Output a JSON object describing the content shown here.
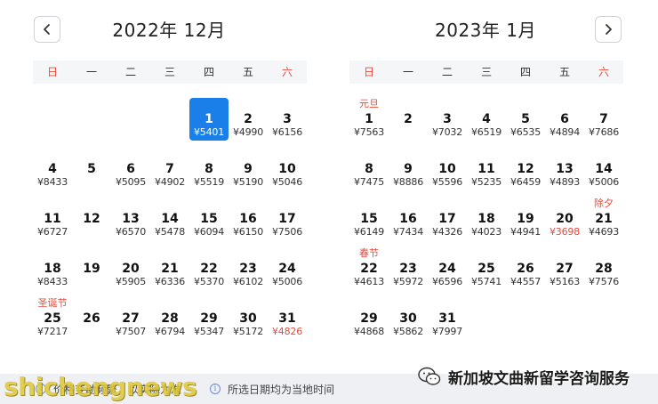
{
  "nav": {
    "prev_icon": "chevron-left-icon",
    "next_icon": "chevron-right-icon"
  },
  "calendars": [
    {
      "title": "2022年 12月",
      "weekdays": [
        "日",
        "一",
        "二",
        "三",
        "四",
        "五",
        "六"
      ],
      "offset": 4,
      "days": [
        {
          "d": "1",
          "p": "¥5401",
          "selected": true
        },
        {
          "d": "2",
          "p": "¥4990"
        },
        {
          "d": "3",
          "p": "¥6156"
        },
        {
          "d": "4",
          "p": "¥8433"
        },
        {
          "d": "5",
          "p": ""
        },
        {
          "d": "6",
          "p": "¥5095"
        },
        {
          "d": "7",
          "p": "¥4902"
        },
        {
          "d": "8",
          "p": "¥5519"
        },
        {
          "d": "9",
          "p": "¥5190"
        },
        {
          "d": "10",
          "p": "¥5046"
        },
        {
          "d": "11",
          "p": "¥6727"
        },
        {
          "d": "12",
          "p": ""
        },
        {
          "d": "13",
          "p": "¥6570"
        },
        {
          "d": "14",
          "p": "¥5478"
        },
        {
          "d": "15",
          "p": "¥6094"
        },
        {
          "d": "16",
          "p": "¥6150"
        },
        {
          "d": "17",
          "p": "¥7506"
        },
        {
          "d": "18",
          "p": "¥8433"
        },
        {
          "d": "19",
          "p": ""
        },
        {
          "d": "20",
          "p": "¥5905"
        },
        {
          "d": "21",
          "p": "¥6336"
        },
        {
          "d": "22",
          "p": "¥5370"
        },
        {
          "d": "23",
          "p": "¥6102"
        },
        {
          "d": "24",
          "p": "¥5006"
        },
        {
          "d": "25",
          "p": "¥7217",
          "holiday": "圣诞节"
        },
        {
          "d": "26",
          "p": ""
        },
        {
          "d": "27",
          "p": "¥7507"
        },
        {
          "d": "28",
          "p": "¥6794"
        },
        {
          "d": "29",
          "p": "¥5347"
        },
        {
          "d": "30",
          "p": "¥5172"
        },
        {
          "d": "31",
          "p": "¥4826",
          "low": true
        }
      ]
    },
    {
      "title": "2023年 1月",
      "weekdays": [
        "日",
        "一",
        "二",
        "三",
        "四",
        "五",
        "六"
      ],
      "offset": 0,
      "days": [
        {
          "d": "1",
          "p": "¥7563",
          "holiday": "元旦"
        },
        {
          "d": "2",
          "p": ""
        },
        {
          "d": "3",
          "p": "¥7032"
        },
        {
          "d": "4",
          "p": "¥6519"
        },
        {
          "d": "5",
          "p": "¥6535"
        },
        {
          "d": "6",
          "p": "¥4894"
        },
        {
          "d": "7",
          "p": "¥7686"
        },
        {
          "d": "8",
          "p": "¥7475"
        },
        {
          "d": "9",
          "p": "¥8886"
        },
        {
          "d": "10",
          "p": "¥5596"
        },
        {
          "d": "11",
          "p": "¥5235"
        },
        {
          "d": "12",
          "p": "¥6459"
        },
        {
          "d": "13",
          "p": "¥4893"
        },
        {
          "d": "14",
          "p": "¥5006"
        },
        {
          "d": "15",
          "p": "¥6149"
        },
        {
          "d": "16",
          "p": "¥7434"
        },
        {
          "d": "17",
          "p": "¥4326"
        },
        {
          "d": "18",
          "p": "¥4023"
        },
        {
          "d": "19",
          "p": "¥4941"
        },
        {
          "d": "20",
          "p": "¥3698",
          "low": true
        },
        {
          "d": "21",
          "p": "¥4693",
          "holiday": "除夕"
        },
        {
          "d": "22",
          "p": "¥4613",
          "holiday": "春节"
        },
        {
          "d": "23",
          "p": "¥5972"
        },
        {
          "d": "24",
          "p": "¥6596"
        },
        {
          "d": "25",
          "p": "¥5741"
        },
        {
          "d": "26",
          "p": "¥4557"
        },
        {
          "d": "27",
          "p": "¥5163"
        },
        {
          "d": "28",
          "p": "¥7576"
        },
        {
          "d": "29",
          "p": "¥4868"
        },
        {
          "d": "30",
          "p": "¥5862"
        },
        {
          "d": "31",
          "p": "¥7997"
        }
      ]
    }
  ],
  "footer": {
    "notice_1": "价格变动频繁，以实际为准",
    "notice_2": "所选日期均为当地时间",
    "info_icon": "info-icon"
  },
  "overlay": {
    "wechat_account": "新加坡文曲新留学咨询服务",
    "wechat_icon": "wechat-icon",
    "watermark": "shichengnews"
  },
  "colors": {
    "accent": "#1a7fe8",
    "weekend": "#e84a3b",
    "low_price": "#e84a3b",
    "header_bg": "#f5f6f8"
  }
}
